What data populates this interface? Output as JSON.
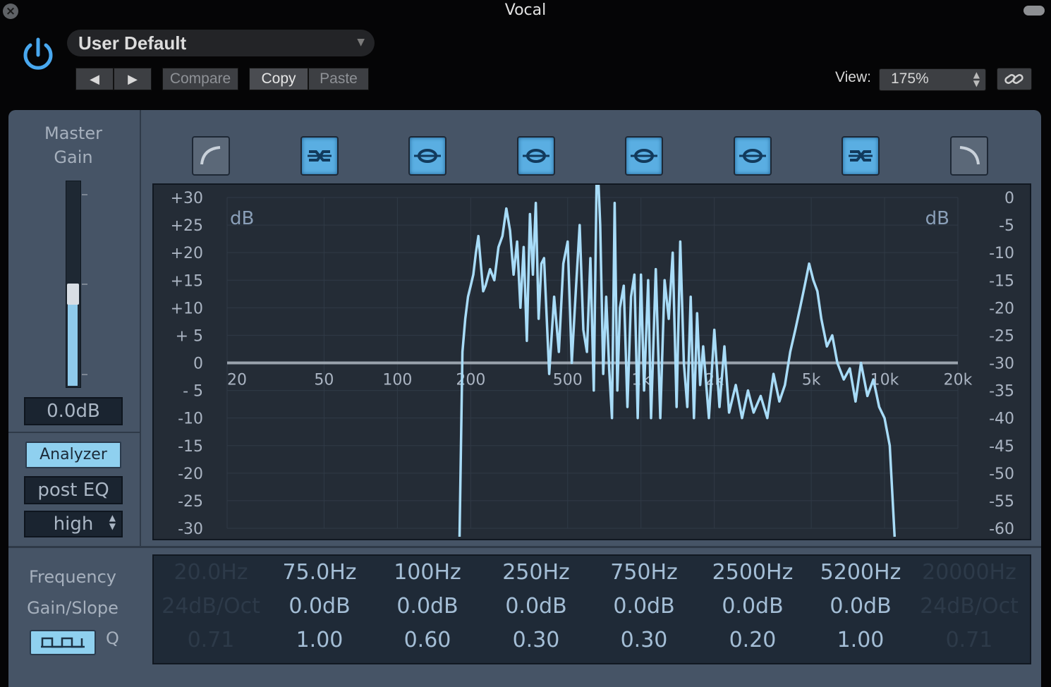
{
  "window": {
    "title": "Vocal"
  },
  "header": {
    "preset": "User Default",
    "compare_label": "Compare",
    "copy_label": "Copy",
    "paste_label": "Paste",
    "view_label": "View:",
    "view_value": "175%"
  },
  "master": {
    "title_line1": "Master",
    "title_line2": "Gain",
    "gain_value": "0.0dB",
    "gain_level": 0.5
  },
  "analyzer": {
    "button_label": "Analyzer",
    "mode_label": "post EQ",
    "resolution_label": "high"
  },
  "param_labels": {
    "frequency": "Frequency",
    "gain_slope": "Gain/Slope",
    "q": "Q"
  },
  "bands": [
    {
      "icon": "low-cut-icon",
      "active": false,
      "freq": "20.0Hz",
      "gain": "24dB/Oct",
      "q": "0.71"
    },
    {
      "icon": "low-shelf-icon",
      "active": true,
      "freq": "75.0Hz",
      "gain": "0.0dB",
      "q": "1.00"
    },
    {
      "icon": "bell-icon",
      "active": true,
      "freq": "100Hz",
      "gain": "0.0dB",
      "q": "0.60"
    },
    {
      "icon": "bell-icon",
      "active": true,
      "freq": "250Hz",
      "gain": "0.0dB",
      "q": "0.30"
    },
    {
      "icon": "bell-icon",
      "active": true,
      "freq": "750Hz",
      "gain": "0.0dB",
      "q": "0.30"
    },
    {
      "icon": "bell-icon",
      "active": true,
      "freq": "2500Hz",
      "gain": "0.0dB",
      "q": "0.20"
    },
    {
      "icon": "high-shelf-icon",
      "active": true,
      "freq": "5200Hz",
      "gain": "0.0dB",
      "q": "1.00"
    },
    {
      "icon": "high-cut-icon",
      "active": false,
      "freq": "20000Hz",
      "gain": "24dB/Oct",
      "q": "0.71"
    }
  ],
  "graph": {
    "left_unit": "dB",
    "right_unit": "dB",
    "left_scale": [
      "+30",
      "+25",
      "+20",
      "+15",
      "+10",
      "+ 5",
      "0",
      "- 5",
      "-10",
      "-15",
      "-20",
      "-25",
      "-30"
    ],
    "right_scale": [
      "0",
      "-5",
      "-10",
      "-15",
      "-20",
      "-25",
      "-30",
      "-35",
      "-40",
      "-45",
      "-50",
      "-55",
      "-60"
    ],
    "freq_labels": [
      "20",
      "50",
      "100",
      "200",
      "500",
      "1k",
      "2k",
      "5k",
      "10k",
      "20k"
    ],
    "freq_values": [
      20,
      50,
      100,
      200,
      500,
      1000,
      2000,
      5000,
      10000,
      20000
    ],
    "eq_curve_gain_db": 0,
    "colors": {
      "spectrum": "#a8dcf8",
      "eq_curve": "#9aa3ad",
      "grid": "#303a46",
      "scale_text": "#aab4c2"
    },
    "spectrum_db": [
      [
        180,
        -70
      ],
      [
        185,
        -28
      ],
      [
        190,
        -22
      ],
      [
        195,
        -18
      ],
      [
        200,
        -16
      ],
      [
        205,
        -14
      ],
      [
        210,
        -10
      ],
      [
        215,
        -7
      ],
      [
        220,
        -12
      ],
      [
        225,
        -17
      ],
      [
        230,
        -16
      ],
      [
        240,
        -13
      ],
      [
        250,
        -15
      ],
      [
        260,
        -9
      ],
      [
        270,
        -7
      ],
      [
        280,
        -2
      ],
      [
        290,
        -6
      ],
      [
        300,
        -14
      ],
      [
        310,
        -8
      ],
      [
        320,
        -20
      ],
      [
        330,
        -9
      ],
      [
        340,
        -26
      ],
      [
        350,
        -3
      ],
      [
        360,
        -14
      ],
      [
        370,
        -1
      ],
      [
        380,
        -22
      ],
      [
        390,
        -12
      ],
      [
        400,
        -11
      ],
      [
        420,
        -32
      ],
      [
        440,
        -18
      ],
      [
        460,
        -28
      ],
      [
        480,
        -12
      ],
      [
        500,
        -8
      ],
      [
        520,
        -30
      ],
      [
        540,
        -17
      ],
      [
        560,
        -5
      ],
      [
        580,
        -24
      ],
      [
        600,
        -28
      ],
      [
        620,
        -11
      ],
      [
        640,
        -35
      ],
      [
        660,
        9
      ],
      [
        680,
        -5
      ],
      [
        700,
        -32
      ],
      [
        720,
        -18
      ],
      [
        740,
        -31
      ],
      [
        760,
        -40
      ],
      [
        780,
        -1
      ],
      [
        800,
        -35
      ],
      [
        820,
        -20
      ],
      [
        850,
        -16
      ],
      [
        880,
        -38
      ],
      [
        910,
        -18
      ],
      [
        940,
        -14
      ],
      [
        970,
        -40
      ],
      [
        1000,
        -14
      ],
      [
        1030,
        -35
      ],
      [
        1070,
        -15
      ],
      [
        1100,
        -40
      ],
      [
        1150,
        -13
      ],
      [
        1200,
        -40
      ],
      [
        1250,
        -15
      ],
      [
        1300,
        -22
      ],
      [
        1350,
        -10
      ],
      [
        1400,
        -38
      ],
      [
        1450,
        -8
      ],
      [
        1500,
        -30
      ],
      [
        1550,
        -38
      ],
      [
        1600,
        -18
      ],
      [
        1650,
        -40
      ],
      [
        1700,
        -21
      ],
      [
        1750,
        -34
      ],
      [
        1800,
        -27
      ],
      [
        1900,
        -40
      ],
      [
        2000,
        -24
      ],
      [
        2100,
        -38
      ],
      [
        2200,
        -27
      ],
      [
        2300,
        -39
      ],
      [
        2450,
        -34
      ],
      [
        2600,
        -40
      ],
      [
        2750,
        -35
      ],
      [
        2900,
        -39
      ],
      [
        3100,
        -36
      ],
      [
        3300,
        -40
      ],
      [
        3500,
        -32
      ],
      [
        3700,
        -37
      ],
      [
        3900,
        -34
      ],
      [
        4100,
        -28
      ],
      [
        4300,
        -24
      ],
      [
        4500,
        -20
      ],
      [
        4700,
        -16
      ],
      [
        4900,
        -12
      ],
      [
        5100,
        -15
      ],
      [
        5300,
        -17
      ],
      [
        5500,
        -22
      ],
      [
        5800,
        -27
      ],
      [
        6100,
        -25
      ],
      [
        6400,
        -30
      ],
      [
        6800,
        -33
      ],
      [
        7200,
        -31
      ],
      [
        7600,
        -37
      ],
      [
        8000,
        -30
      ],
      [
        8500,
        -36
      ],
      [
        9000,
        -33
      ],
      [
        9500,
        -38
      ],
      [
        10000,
        -40
      ],
      [
        10500,
        -45
      ],
      [
        11000,
        -70
      ]
    ]
  }
}
